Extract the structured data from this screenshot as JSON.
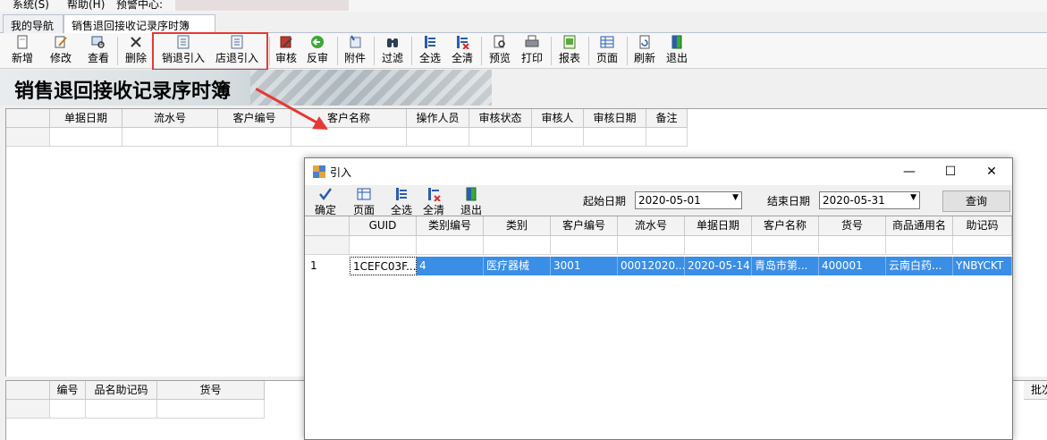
{
  "menu": {
    "items": [
      "系统(S)",
      "帮助(H)",
      "预警中心:"
    ]
  },
  "tabs": [
    {
      "label": "我的导航"
    },
    {
      "label": "销售退回接收记录序时簿",
      "close": "✕"
    }
  ],
  "toolbar": {
    "buttons": [
      "新增",
      "修改",
      "查看",
      "删除",
      "销退引入",
      "店退引入",
      "审核",
      "反审",
      "附件",
      "过滤",
      "全选",
      "全清",
      "预览",
      "打印",
      "报表",
      "页面",
      "刷新",
      "退出"
    ]
  },
  "banner": {
    "title": "销售退回接收记录序时簿"
  },
  "main_grid": {
    "columns": [
      "单据日期",
      "流水号",
      "客户编号",
      "客户名称",
      "操作人员",
      "审核状态",
      "审核人",
      "审核日期",
      "备注"
    ]
  },
  "bottom_grid": {
    "columns": [
      "编号",
      "品名助记码",
      "货号"
    ],
    "right_col": "批次"
  },
  "dialog": {
    "title": "引入",
    "toolbar": [
      "确定",
      "页面",
      "全选",
      "全清",
      "退出"
    ],
    "start_label": "起始日期",
    "start_date": "2020-05-01",
    "end_label": "结束日期",
    "end_date": "2020-05-31",
    "query_label": "查询",
    "columns": [
      "GUID",
      "类别编号",
      "类别",
      "客户编号",
      "流水号",
      "单据日期",
      "客户名称",
      "货号",
      "商品通用名",
      "助记码"
    ],
    "rows": [
      [
        "1",
        "1CEFC03F...",
        "4",
        "医疗器械",
        "3001",
        "00012020...",
        "2020-05-14",
        "青岛市第...",
        "400001",
        "云南白药...",
        "YNBYCKT"
      ]
    ]
  },
  "colors": {
    "highlight": "#e53935",
    "selection": "#3a8ee6"
  }
}
